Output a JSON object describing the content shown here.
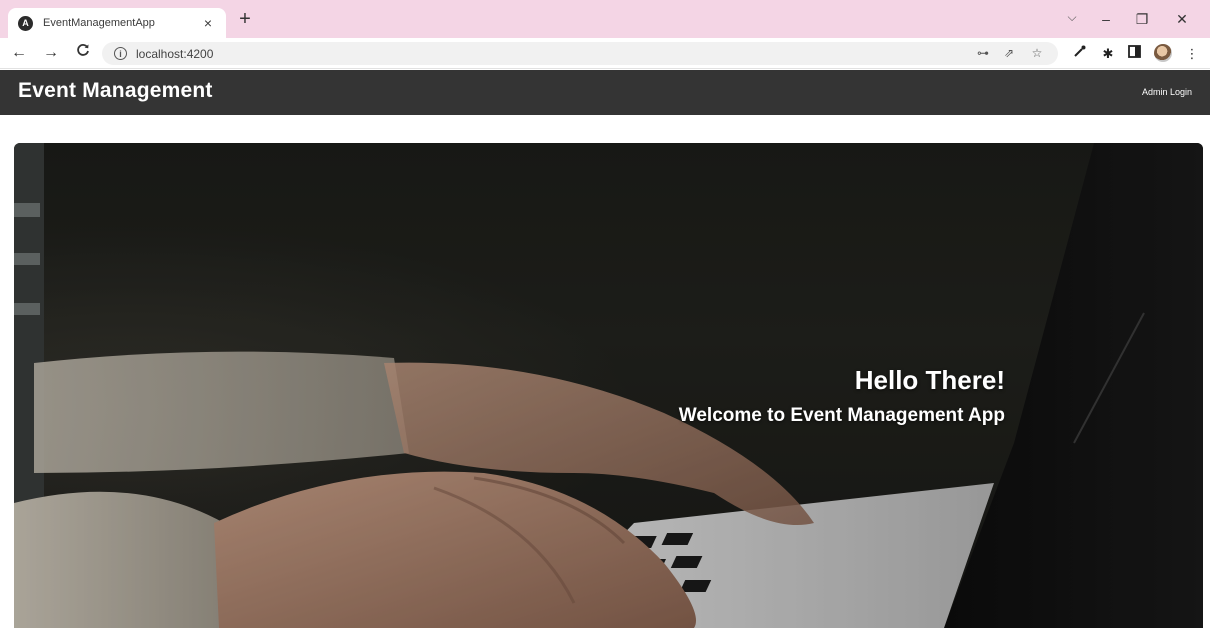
{
  "browser": {
    "tab_title": "EventManagementApp",
    "tab_close": "×",
    "new_tab": "+",
    "url": "localhost:4200",
    "window_controls": {
      "minimize": "–",
      "restore": "❐",
      "close": "✕"
    }
  },
  "icons": {
    "favicon": "angular-icon",
    "back": "back-arrow-icon",
    "forward": "forward-arrow-icon",
    "reload": "reload-icon",
    "info": "info-icon",
    "key": "key-icon",
    "share": "share-icon",
    "star": "star-icon",
    "eyedropper": "eyedropper-icon",
    "extensions": "puzzle-icon",
    "sidepanel": "side-panel-icon",
    "menu": "kebab-menu-icon"
  },
  "navbar": {
    "brand": "Event Management",
    "admin_login": "Admin Login"
  },
  "hero": {
    "title": "Hello There!",
    "subtitle": "Welcome to Event Management App"
  },
  "colors": {
    "tab_strip": "#f4d5e5",
    "navbar": "#343434",
    "hero_bg": "#1d1e1a",
    "text_on_dark": "#ffffff"
  }
}
